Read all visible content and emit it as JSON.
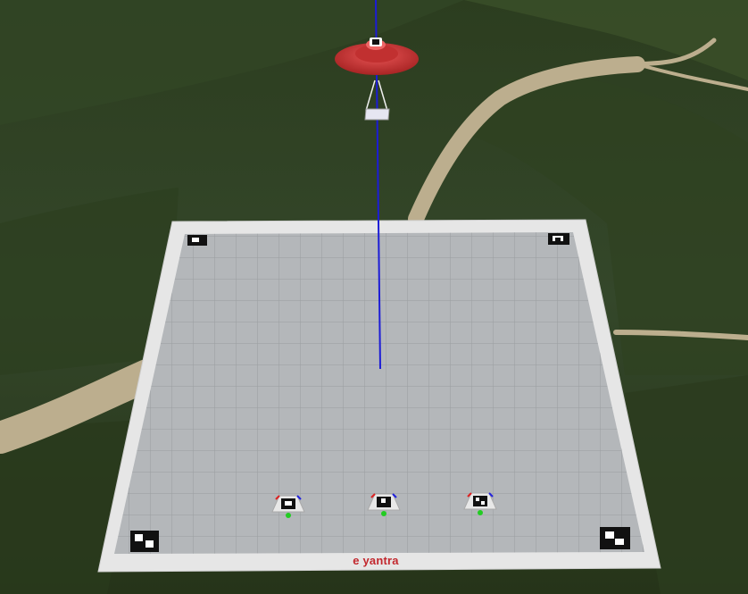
{
  "scene": {
    "title": "",
    "brand_logo": "e-yantra",
    "brand_text": "e yantra",
    "colors": {
      "terrain_dark": "#26361a",
      "terrain_mid": "#3a4e26",
      "path": "#bcae8e",
      "arena_border": "#e6e6e6",
      "arena_floor": "#b4b7ba",
      "grid_line": "#9a9da0",
      "drone_body": "#d33a3a",
      "tether": "#1c1cd6",
      "brand": "#c2272d"
    },
    "objects": [
      {
        "name": "drone",
        "icon": "saucer-drone-icon",
        "marker_glyph": "aruco-marker-icon"
      },
      {
        "name": "payload",
        "icon": "payload-box-icon"
      },
      {
        "name": "tether-line",
        "icon": "line"
      },
      {
        "name": "arena",
        "icon": "grid-floor",
        "grid": true
      }
    ],
    "corner_markers": [
      "aruco-top-left",
      "aruco-top-right",
      "aruco-bottom-left",
      "aruco-bottom-right"
    ],
    "robots": [
      {
        "name": "robot-1",
        "icon": "aruco-robot-icon"
      },
      {
        "name": "robot-2",
        "icon": "aruco-robot-icon"
      },
      {
        "name": "robot-3",
        "icon": "aruco-robot-icon"
      }
    ]
  }
}
